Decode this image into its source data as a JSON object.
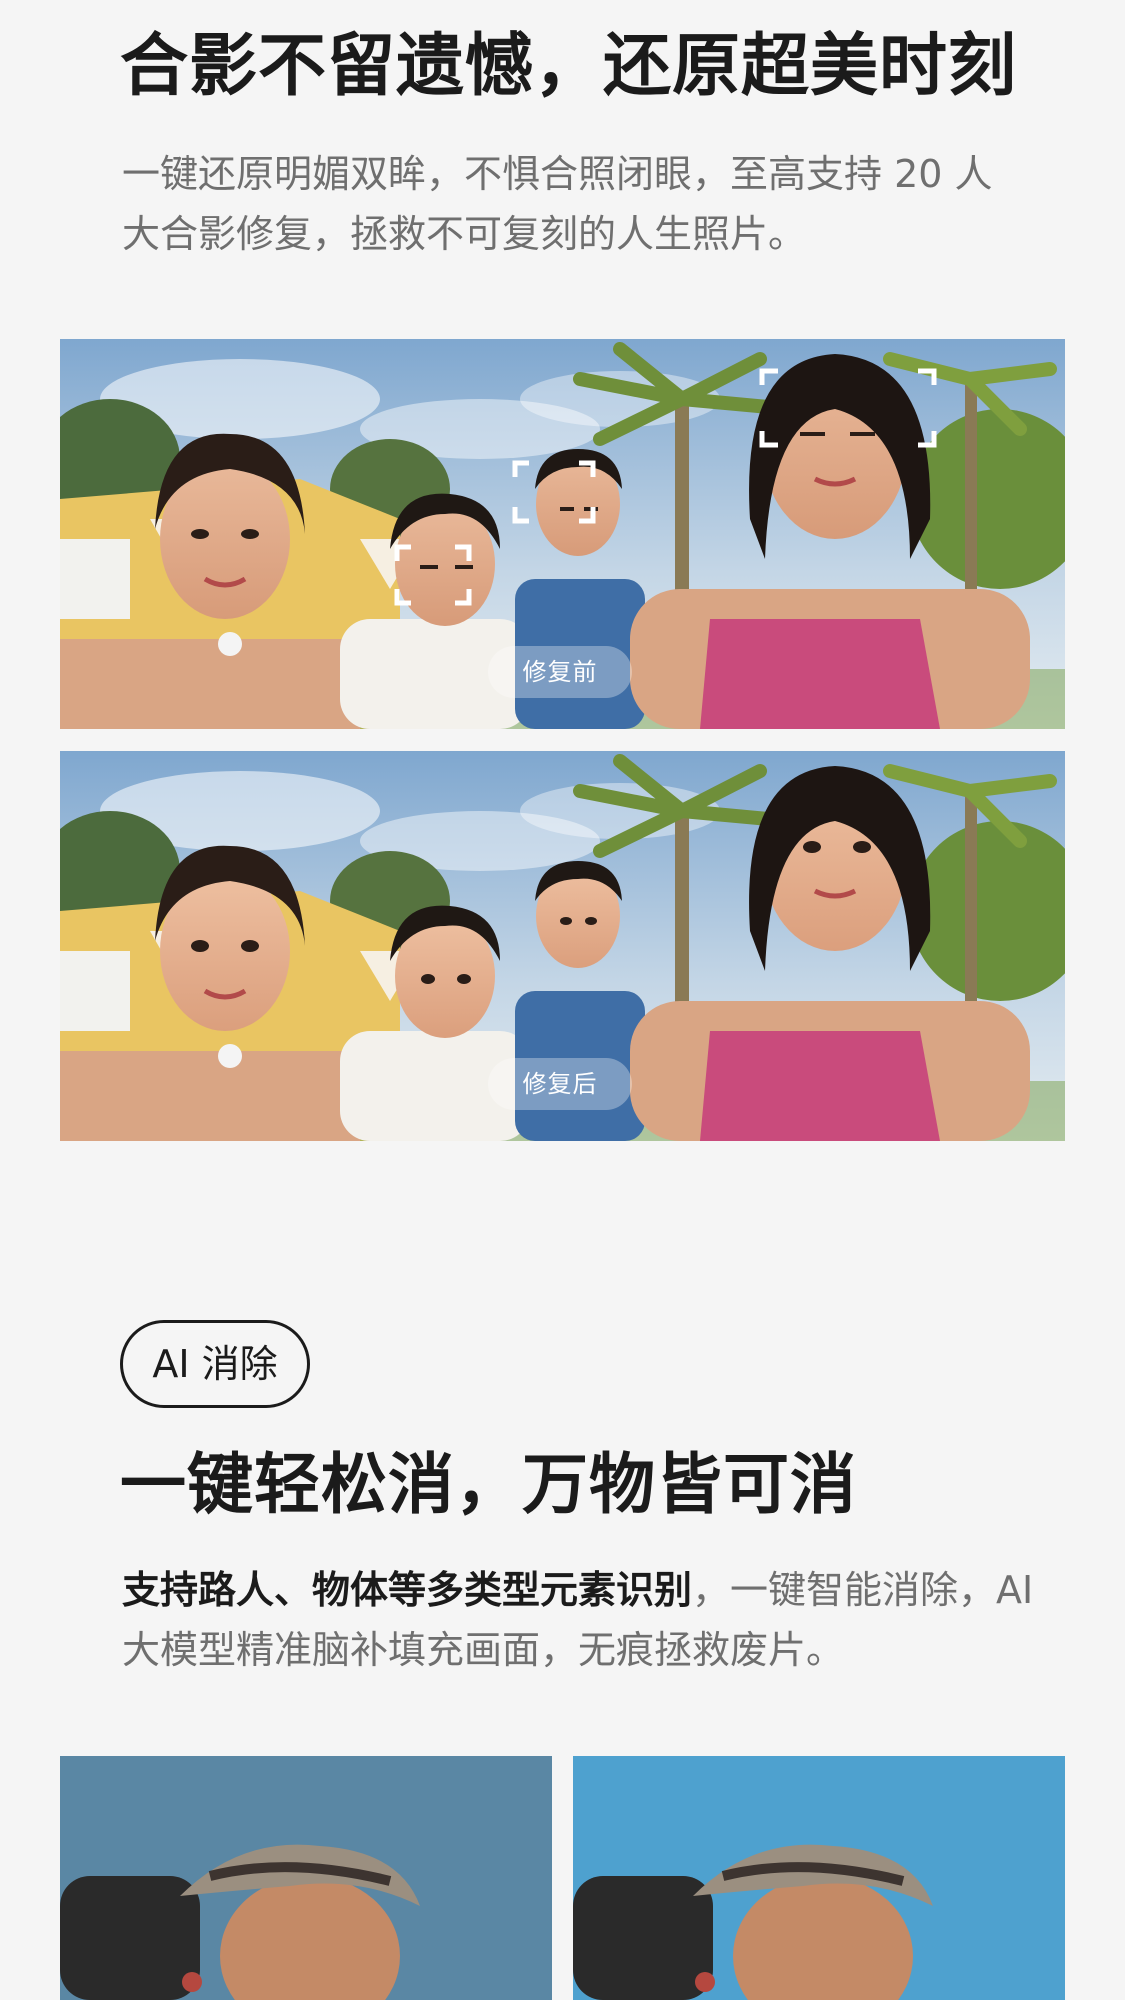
{
  "section1": {
    "title": "合影不留遗憾，还原超美时刻",
    "description": "一键还原明媚双眸，不惧合照闭眼，至高支持 20 人大合影修复，拯救不可复刻的人生照片。"
  },
  "photos": {
    "before_label": "修复前",
    "after_label": "修复后"
  },
  "section2": {
    "badge": "AI 消除",
    "title": "一键轻松消，万物皆可消",
    "description_bold": "支持路人、物体等多类型元素识别",
    "description_rest": "，一键智能消除，AI 大模型精准脑补填充画面，无痕拯救废片。"
  },
  "colors": {
    "background": "#f5f5f5",
    "title_text": "#1b1b1b",
    "body_text": "#6f6f6f",
    "focus_brackets": "#ffffff"
  },
  "icons": [
    "focus-bracket-icon"
  ]
}
